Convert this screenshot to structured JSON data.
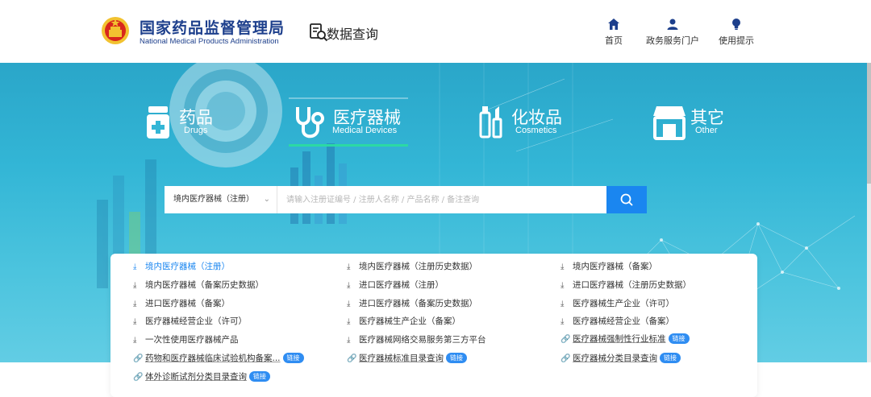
{
  "header": {
    "org_cn": "国家药品监督管理局",
    "org_en": "National Medical Products Administration",
    "section_label": "数据查询",
    "nav": [
      {
        "label": "首页",
        "icon": "home-icon"
      },
      {
        "label": "政务服务门户",
        "icon": "user-icon"
      },
      {
        "label": "使用提示",
        "icon": "lightbulb-icon"
      }
    ]
  },
  "categories": [
    {
      "cn": "药品",
      "en": "Drugs",
      "icon": "medicine-bottle-icon"
    },
    {
      "cn": "医疗器械",
      "en": "Medical Devices",
      "icon": "stethoscope-icon",
      "active": true
    },
    {
      "cn": "化妆品",
      "en": "Cosmetics",
      "icon": "cosmetics-icon"
    },
    {
      "cn": "其它",
      "en": "Other",
      "icon": "store-icon"
    }
  ],
  "search": {
    "selected": "境内医疗器械（注册）",
    "placeholder": "请输入注册证编号 / 注册人名称 / 产品名称 / 备注查询"
  },
  "quick_links": {
    "badge": "链接",
    "items": [
      {
        "label": "境内医疗器械（注册）",
        "icon": "upload-icon",
        "active": true
      },
      {
        "label": "境内医疗器械（注册历史数据）",
        "icon": "upload-icon"
      },
      {
        "label": "境内医疗器械（备案）",
        "icon": "upload-icon"
      },
      {
        "label": "境内医疗器械（备案历史数据）",
        "icon": "upload-icon"
      },
      {
        "label": "进口医疗器械（注册）",
        "icon": "upload-icon"
      },
      {
        "label": "进口医疗器械（注册历史数据）",
        "icon": "upload-icon"
      },
      {
        "label": "进口医疗器械（备案）",
        "icon": "upload-icon"
      },
      {
        "label": "进口医疗器械（备案历史数据）",
        "icon": "upload-icon"
      },
      {
        "label": "医疗器械生产企业（许可）",
        "icon": "upload-icon"
      },
      {
        "label": "医疗器械经营企业（许可）",
        "icon": "upload-icon"
      },
      {
        "label": "医疗器械生产企业（备案）",
        "icon": "upload-icon"
      },
      {
        "label": "医疗器械经营企业（备案）",
        "icon": "upload-icon"
      },
      {
        "label": "一次性使用医疗器械产品",
        "icon": "upload-icon"
      },
      {
        "label": "医疗器械网络交易服务第三方平台",
        "icon": "upload-icon"
      },
      {
        "label": "医疗器械强制性行业标准",
        "icon": "link-icon",
        "link": true
      },
      {
        "label": "药物和医疗器械临床试验机构备案...",
        "icon": "link-icon",
        "link": true
      },
      {
        "label": "医疗器械标准目录查询",
        "icon": "link-icon",
        "link": true
      },
      {
        "label": "医疗器械分类目录查询",
        "icon": "link-icon",
        "link": true
      },
      {
        "label": "体外诊断试剂分类目录查询",
        "icon": "link-icon",
        "link": true
      }
    ]
  },
  "colors": {
    "brand_blue": "#1d3f8c",
    "accent_blue": "#1a86f0",
    "active_underline": "#2bd9a4",
    "banner": "#33b6d6"
  }
}
